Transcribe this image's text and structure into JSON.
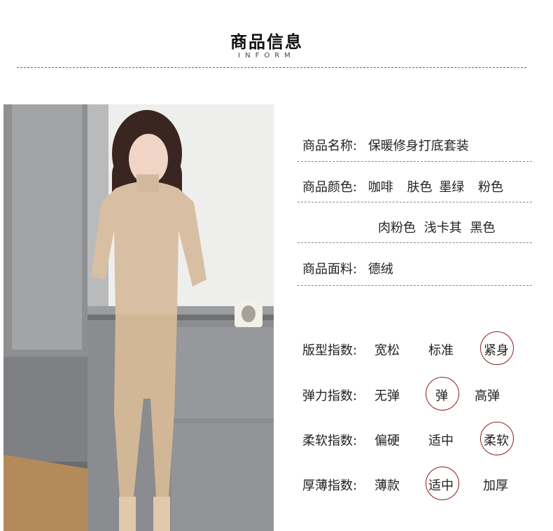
{
  "header": {
    "title": "商品信息",
    "subtitle": "INFORM"
  },
  "info": {
    "name_label": "商品名称:",
    "name_value": "保暖修身打底套装",
    "color_label": "商品颜色:",
    "color_values_line1": [
      "咖啡",
      "肤色",
      "墨绿",
      "粉色"
    ],
    "color_values_line2": [
      "肉粉色",
      "浅卡其",
      "黑色"
    ],
    "fabric_label": "商品面料:",
    "fabric_value": "德绒"
  },
  "indices": [
    {
      "label": "版型指数:",
      "options": [
        "宽松",
        "标准",
        "紧身"
      ],
      "selected": "紧身"
    },
    {
      "label": "弹力指数:",
      "options": [
        "无弹",
        "弹",
        "高弹"
      ],
      "selected": "弹"
    },
    {
      "label": "柔软指数:",
      "options": [
        "偏硬",
        "适中",
        "柔软"
      ],
      "selected": "柔软"
    },
    {
      "label": "厚薄指数:",
      "options": [
        "薄款",
        "适中",
        "加厚"
      ],
      "selected": "适中"
    }
  ],
  "colors": {
    "circle": "#8a1f1f",
    "garment": "#d8bfa3",
    "background": "#ffffff"
  }
}
